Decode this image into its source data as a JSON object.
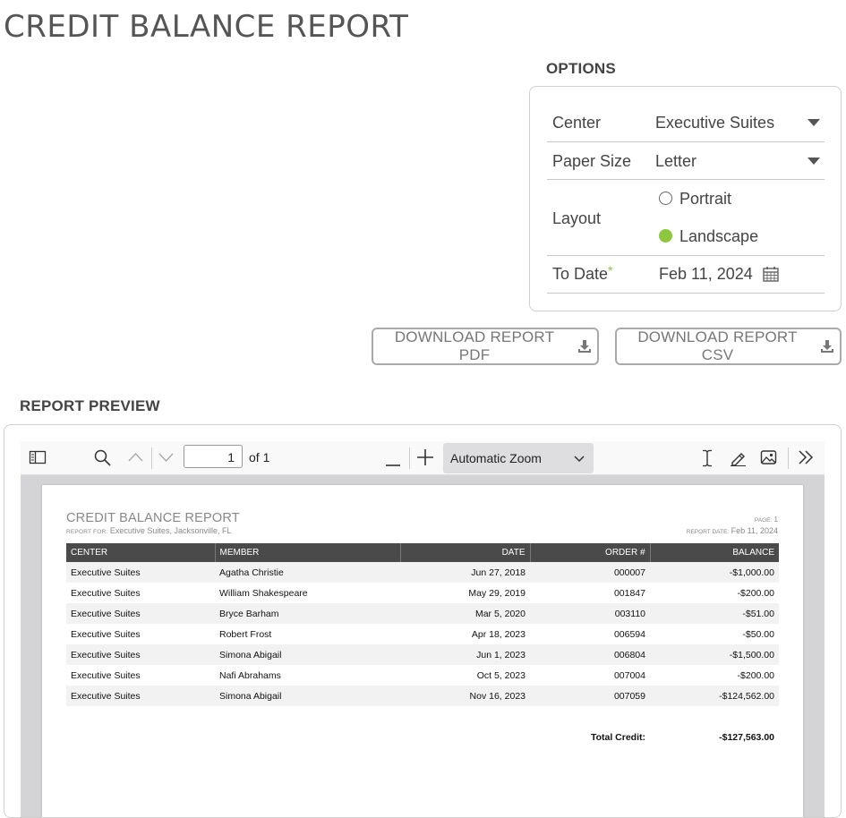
{
  "page": {
    "title": "CREDIT BALANCE REPORT"
  },
  "options": {
    "title": "OPTIONS",
    "center": {
      "label": "Center",
      "value": "Executive Suites"
    },
    "paper_size": {
      "label": "Paper Size",
      "value": "Letter"
    },
    "layout": {
      "label": "Layout",
      "options": [
        "Portrait",
        "Landscape"
      ],
      "selected": "Landscape"
    },
    "to_date": {
      "label": "To Date",
      "required_mark": "*",
      "value": "Feb 11, 2024"
    }
  },
  "buttons": {
    "download_pdf": "DOWNLOAD REPORT PDF",
    "download_csv": "DOWNLOAD REPORT CSV"
  },
  "preview": {
    "title": "REPORT PREVIEW",
    "toolbar": {
      "page_number": "1",
      "page_of": "of 1",
      "zoom": "Automatic Zoom"
    },
    "report": {
      "title": "CREDIT BALANCE REPORT",
      "report_for_label": "REPORT FOR:",
      "report_for": "Executive Suites, Jacksonville, FL",
      "page_label": "PAGE:",
      "page": "1",
      "report_date_label": "REPORT DATE:",
      "report_date": "Feb 11, 2024",
      "columns": [
        "CENTER",
        "MEMBER",
        "DATE",
        "ORDER #",
        "BALANCE"
      ],
      "rows": [
        [
          "Executive Suites",
          "Agatha Christie",
          "Jun 27, 2018",
          "000007",
          "-$1,000.00"
        ],
        [
          "Executive Suites",
          "William Shakespeare",
          "May 29, 2019",
          "001847",
          "-$200.00"
        ],
        [
          "Executive Suites",
          "Bryce Barham",
          "Mar 5, 2020",
          "003110",
          "-$51.00"
        ],
        [
          "Executive Suites",
          "Robert Frost",
          "Apr 18, 2023",
          "006594",
          "-$50.00"
        ],
        [
          "Executive Suites",
          "Simona Abigail",
          "Jun 1, 2023",
          "006804",
          "-$1,500.00"
        ],
        [
          "Executive Suites",
          "Nafi Abrahams",
          "Oct 5, 2023",
          "007004",
          "-$200.00"
        ],
        [
          "Executive Suites",
          "Simona Abigail",
          "Nov 16, 2023",
          "007059",
          "-$124,562.00"
        ]
      ],
      "total_label": "Total Credit:",
      "total_value": "-$127,563.00"
    }
  },
  "colors": {
    "accent_green": "#8dc63f",
    "table_header": "#4a4a4a"
  }
}
